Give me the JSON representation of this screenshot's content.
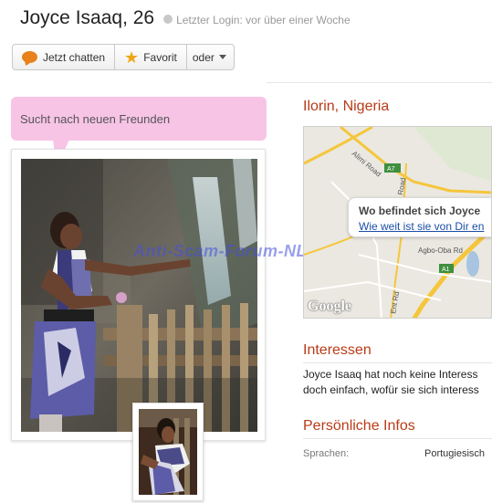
{
  "header": {
    "name": "Joyce Isaaq, 26",
    "last_login": "Letzter Login: vor über einer Woche"
  },
  "actions": {
    "chat_label": "Jetzt chatten",
    "favorite_label": "Favorit",
    "more_label": "oder"
  },
  "status_text": "Sucht nach neuen Freunden",
  "watermark": "Anti-Scam-Forum-NL",
  "location": {
    "title": "Ilorin, Nigeria",
    "map_question": "Wo befindet sich Joyce",
    "map_link": "Wie weit ist sie von Dir en",
    "map_attribution": "Google",
    "road_labels": [
      "Alimi Road",
      "A7",
      "Road",
      "A1",
      "Agbo-Oba Rd",
      "Ent Rd"
    ]
  },
  "interests": {
    "title": "Interessen",
    "lines": [
      "Joyce Isaaq hat noch keine Interess",
      "doch einfach, wofür sie sich interess"
    ]
  },
  "personal": {
    "title": "Persönliche Infos",
    "language_label": "Sprachen:",
    "language_value": "Portugiesisch"
  },
  "colors": {
    "accent": "#b83b16",
    "bubble": "#f7c4e6",
    "link": "#1a4ea6",
    "road": "#f5c63c"
  }
}
